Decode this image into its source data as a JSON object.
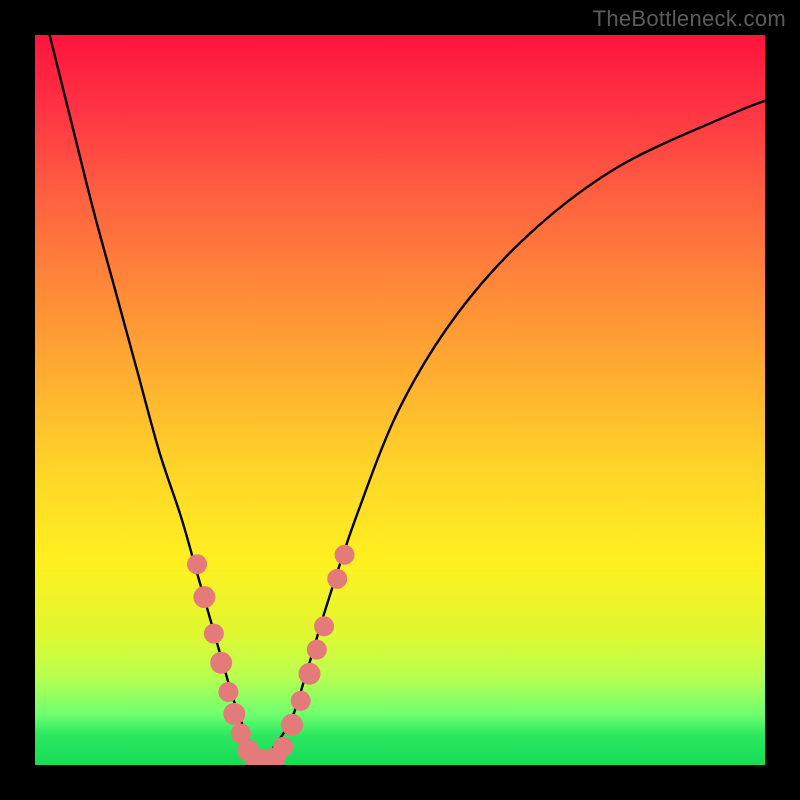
{
  "watermark": "TheBottleneck.com",
  "chart_data": {
    "type": "line",
    "title": "",
    "xlabel": "",
    "ylabel": "",
    "xlim": [
      0,
      100
    ],
    "ylim": [
      0,
      100
    ],
    "series": [
      {
        "name": "bottleneck-curve",
        "x": [
          2,
          5,
          8,
          11,
          14,
          17,
          20,
          22,
          24,
          26,
          27.5,
          29,
          30,
          31,
          32,
          35,
          37,
          40,
          44,
          50,
          58,
          68,
          80,
          95,
          100
        ],
        "y": [
          100,
          88,
          76,
          65,
          54,
          43,
          34,
          27,
          20,
          13,
          8,
          4,
          1.5,
          0.5,
          1.5,
          6,
          12,
          22,
          34,
          49,
          62,
          73,
          82,
          89,
          91
        ]
      }
    ],
    "markers": {
      "color": "#e47a7a",
      "points": [
        {
          "x": 22.2,
          "y": 27.5,
          "r": 10
        },
        {
          "x": 23.2,
          "y": 23.0,
          "r": 11
        },
        {
          "x": 24.5,
          "y": 18.0,
          "r": 10
        },
        {
          "x": 25.5,
          "y": 14.0,
          "r": 11
        },
        {
          "x": 26.5,
          "y": 10.0,
          "r": 10
        },
        {
          "x": 27.3,
          "y": 7.0,
          "r": 11
        },
        {
          "x": 28.2,
          "y": 4.3,
          "r": 10
        },
        {
          "x": 29.2,
          "y": 2.0,
          "r": 11
        },
        {
          "x": 30.2,
          "y": 0.9,
          "r": 11
        },
        {
          "x": 31.5,
          "y": 0.7,
          "r": 11
        },
        {
          "x": 32.8,
          "y": 0.9,
          "r": 11
        },
        {
          "x": 34.0,
          "y": 2.5,
          "r": 10
        },
        {
          "x": 35.2,
          "y": 5.5,
          "r": 11
        },
        {
          "x": 36.4,
          "y": 8.8,
          "r": 10
        },
        {
          "x": 37.6,
          "y": 12.5,
          "r": 11
        },
        {
          "x": 38.6,
          "y": 15.8,
          "r": 10
        },
        {
          "x": 39.6,
          "y": 19.0,
          "r": 10
        },
        {
          "x": 41.4,
          "y": 25.5,
          "r": 10
        },
        {
          "x": 42.4,
          "y": 28.8,
          "r": 10
        }
      ]
    }
  }
}
